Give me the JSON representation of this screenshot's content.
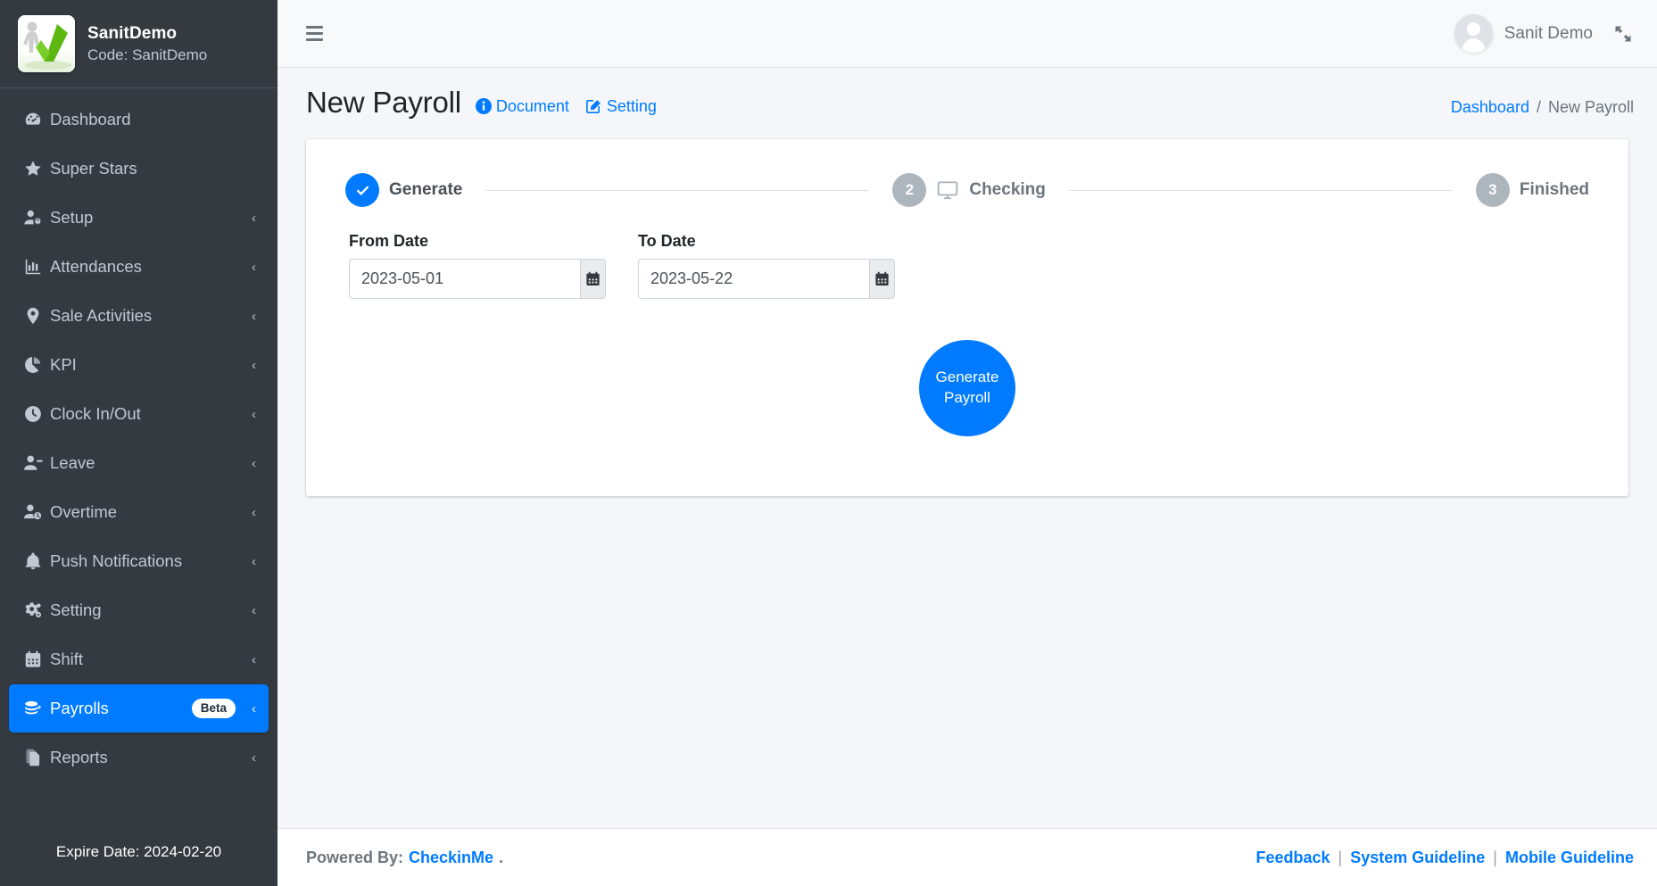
{
  "sidebar": {
    "brand": {
      "title": "SanitDemo",
      "code": "Code: SanitDemo",
      "logo_icon": "checkmark-person-logo"
    },
    "items": [
      {
        "label": "Dashboard",
        "icon": "tachometer-icon",
        "chevron": "",
        "badge": "",
        "active": false
      },
      {
        "label": "Super Stars",
        "icon": "star-icon",
        "chevron": "",
        "badge": "",
        "active": false
      },
      {
        "label": "Setup",
        "icon": "user-gear-icon",
        "chevron": "‹",
        "badge": "",
        "active": false
      },
      {
        "label": "Attendances",
        "icon": "chart-bar-icon",
        "chevron": "‹",
        "badge": "",
        "active": false
      },
      {
        "label": "Sale Activities",
        "icon": "map-marker-icon",
        "chevron": "‹",
        "badge": "",
        "active": false
      },
      {
        "label": "KPI",
        "icon": "chart-pie-icon",
        "chevron": "‹",
        "badge": "",
        "active": false
      },
      {
        "label": "Clock In/Out",
        "icon": "clock-icon",
        "chevron": "‹",
        "badge": "",
        "active": false
      },
      {
        "label": "Leave",
        "icon": "user-minus-icon",
        "chevron": "‹",
        "badge": "",
        "active": false
      },
      {
        "label": "Overtime",
        "icon": "user-clock-icon",
        "chevron": "‹",
        "badge": "",
        "active": false
      },
      {
        "label": "Push Notifications",
        "icon": "bell-icon",
        "chevron": "‹",
        "badge": "",
        "active": false
      },
      {
        "label": "Setting",
        "icon": "cogs-icon",
        "chevron": "‹",
        "badge": "",
        "active": false
      },
      {
        "label": "Shift",
        "icon": "calendar-icon",
        "chevron": "‹",
        "badge": "",
        "active": false
      },
      {
        "label": "Payrolls",
        "icon": "coins-icon",
        "chevron": "‹",
        "badge": "Beta",
        "active": true
      },
      {
        "label": "Reports",
        "icon": "copy-files-icon",
        "chevron": "‹",
        "badge": "",
        "active": false
      }
    ],
    "expire": "Expire Date: 2024-02-20"
  },
  "topbar": {
    "menu_icon": "hamburger-icon",
    "user_name": "Sanit Demo",
    "avatar_icon": "user-avatar-icon",
    "expand_icon": "expand-arrows-icon"
  },
  "page": {
    "title": "New Payroll",
    "links": [
      {
        "label": "Document",
        "icon": "info-circle-icon"
      },
      {
        "label": "Setting",
        "icon": "edit-pencil-icon"
      }
    ],
    "breadcrumb": {
      "root": "Dashboard",
      "separator": "/",
      "current": "New Payroll"
    }
  },
  "wizard": {
    "steps": [
      {
        "number": "",
        "label": "Generate",
        "state": "done",
        "marker": "✔",
        "icon": ""
      },
      {
        "number": "2",
        "label": "Checking",
        "state": "pending",
        "marker": "2",
        "icon": "desktop-icon"
      },
      {
        "number": "3",
        "label": "Finished",
        "state": "pending",
        "marker": "3",
        "icon": ""
      }
    ]
  },
  "form": {
    "from_date": {
      "label": "From Date",
      "value": "2023-05-01",
      "placeholder": "YYYY-MM-DD",
      "addon_icon": "calendar-icon"
    },
    "to_date": {
      "label": "To Date",
      "value": "2023-05-22",
      "placeholder": "YYYY-MM-DD",
      "addon_icon": "calendar-icon"
    },
    "submit_line1": "Generate",
    "submit_line2": "Payroll"
  },
  "footer": {
    "powered_prefix": "Powered By:",
    "powered_brand": "CheckinMe",
    "powered_suffix": ".",
    "links": [
      {
        "label": "Feedback"
      },
      {
        "label": "System Guideline"
      },
      {
        "label": "Mobile Guideline"
      }
    ],
    "separator": "|"
  },
  "colors": {
    "sidebar_bg": "#343a40",
    "accent": "#007bff",
    "page_bg": "#f4f6f9",
    "card_bg": "#ffffff",
    "muted": "#6c757d",
    "step_pending": "#adb5bd"
  }
}
